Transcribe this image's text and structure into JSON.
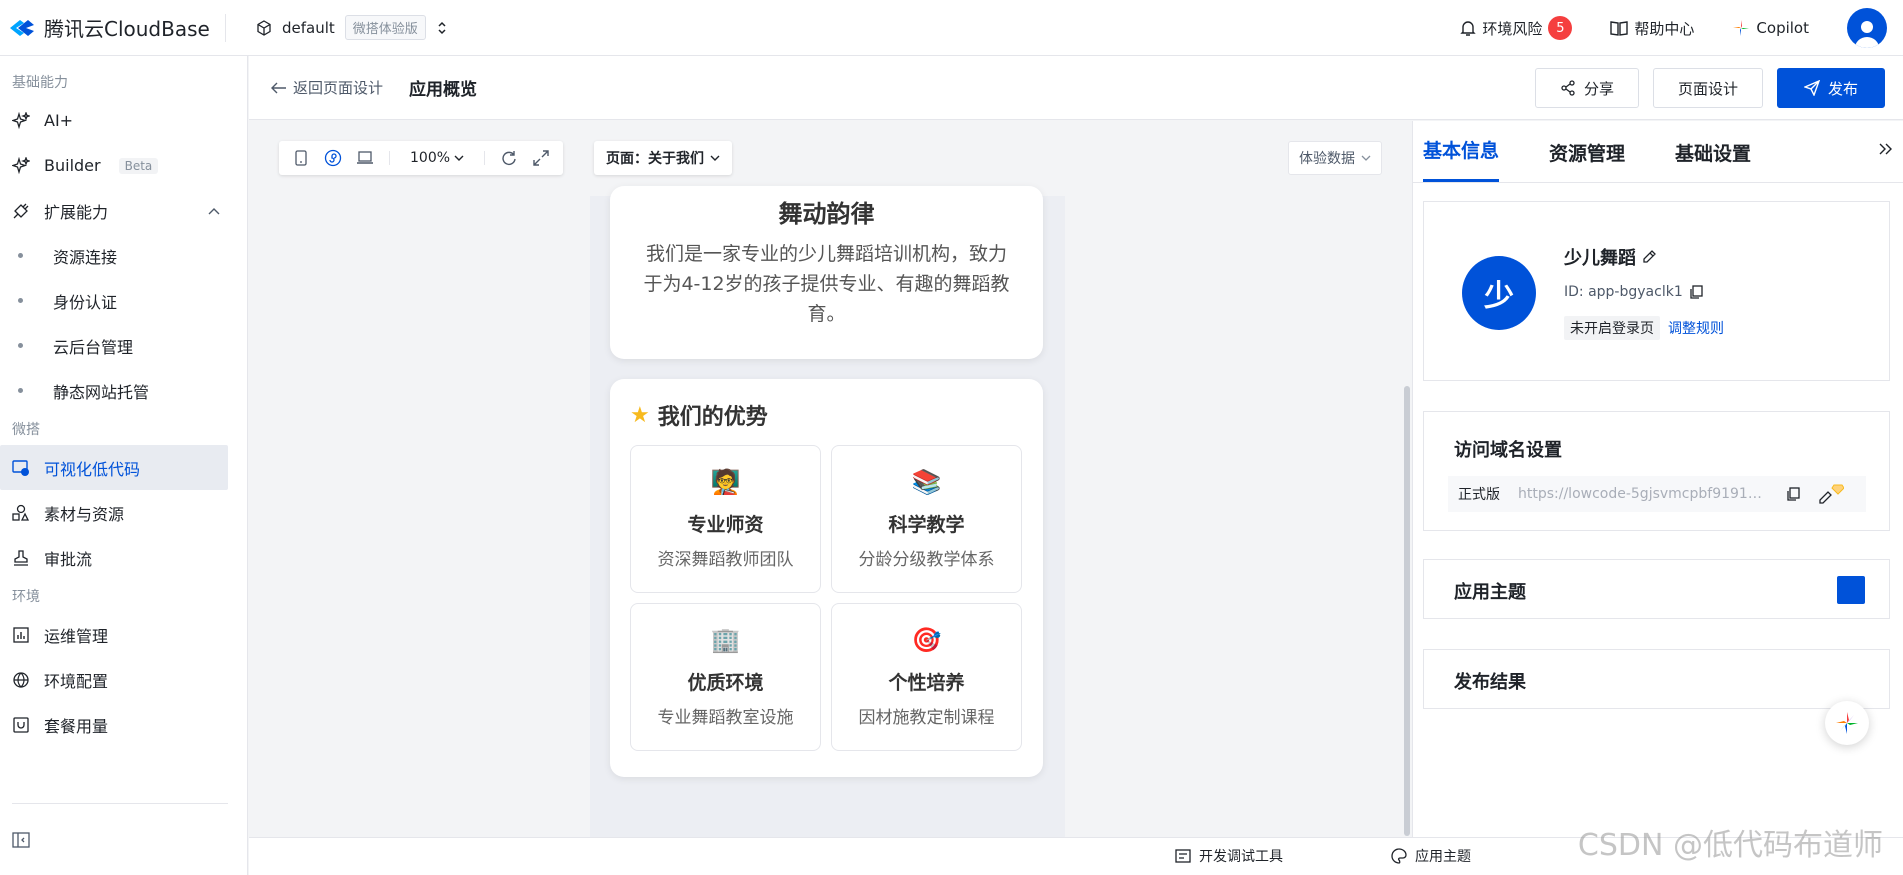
{
  "topbar": {
    "brand": "腾讯云CloudBase",
    "env_name": "default",
    "env_badge": "微搭体验版",
    "env_risk": "环境风险",
    "risk_count": "5",
    "help": "帮助中心",
    "copilot": "Copilot"
  },
  "sidebar": {
    "sections": {
      "basic": "基础能力",
      "weida": "微搭",
      "env": "环境"
    },
    "items": {
      "ai": "AI+",
      "builder": "Builder",
      "builder_badge": "Beta",
      "ext": "扩展能力",
      "res_conn": "资源连接",
      "auth": "身份认证",
      "cloud_admin": "云后台管理",
      "static_host": "静态网站托管",
      "lowcode": "可视化低代码",
      "materials": "素材与资源",
      "approval": "审批流",
      "ops": "运维管理",
      "env_config": "环境配置",
      "plan_usage": "套餐用量"
    }
  },
  "header": {
    "back": "返回页面设计",
    "title": "应用概览",
    "share": "分享",
    "page_design": "页面设计",
    "publish": "发布"
  },
  "canvas": {
    "zoom": "100%",
    "page_select": "页面：关于我们",
    "data_exp": "体验数据"
  },
  "preview": {
    "intro_title": "舞动韵律",
    "intro_text": "我们是一家专业的少儿舞蹈培训机构，致力于为4-12岁的孩子提供专业、有趣的舞蹈教育。",
    "adv_title": "我们的优势",
    "features": [
      {
        "icon": "🧑‍🏫",
        "title": "专业师资",
        "desc": "资深舞蹈教师团队"
      },
      {
        "icon": "📚",
        "title": "科学教学",
        "desc": "分龄分级教学体系"
      },
      {
        "icon": "🏢",
        "title": "优质环境",
        "desc": "专业舞蹈教室设施"
      },
      {
        "icon": "🎯",
        "title": "个性培养",
        "desc": "因材施教定制课程"
      }
    ]
  },
  "panel": {
    "tabs": [
      "基本信息",
      "资源管理",
      "基础设置"
    ],
    "app_avatar": "少",
    "app_name": "少儿舞蹈",
    "app_id": "ID: app-bgyaclk1",
    "login_tag": "未开启登录页",
    "login_link": "调整规则",
    "domain_title": "访问域名设置",
    "domain_env": "正式版",
    "domain_url": "https://lowcode-5gjsvmcpbf91914b...",
    "theme_title": "应用主题",
    "theme_color": "#0052d9",
    "result_title": "发布结果"
  },
  "bottombar": {
    "devtools": "开发调试工具",
    "theme": "应用主题"
  },
  "watermark": "CSDN @低代码布道师"
}
